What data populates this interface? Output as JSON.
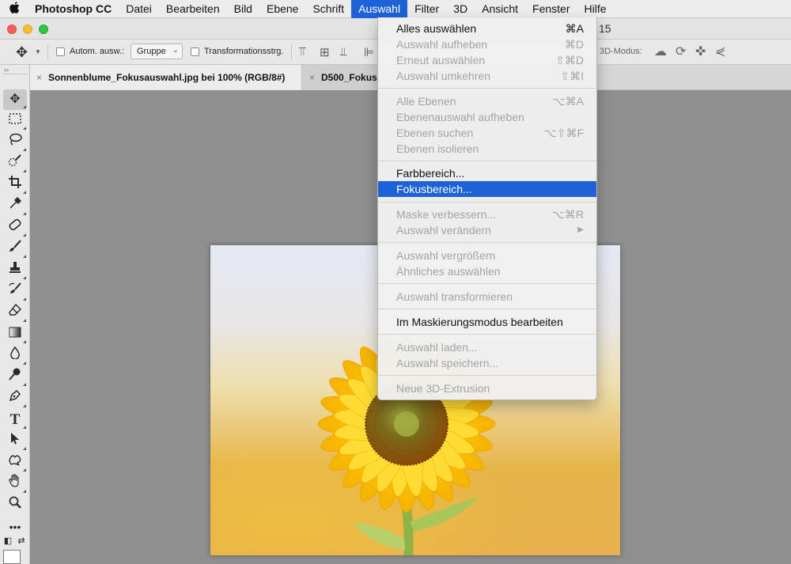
{
  "menubar": {
    "apple": "",
    "app_name": "Photoshop CC",
    "items": [
      "Datei",
      "Bearbeiten",
      "Bild",
      "Ebene",
      "Schrift",
      "Auswahl",
      "Filter",
      "3D",
      "Ansicht",
      "Fenster",
      "Hilfe"
    ],
    "active": "Auswahl"
  },
  "window": {
    "title_fragment": "15"
  },
  "options_bar": {
    "auto_select_label": "Autom. ausw.:",
    "auto_select_checked": false,
    "group_value": "Gruppe",
    "transform_label": "Transformationsstrg.",
    "transform_checked": false,
    "mode_3d_label": "3D-Modus:"
  },
  "tabs": [
    {
      "close": "×",
      "label": "Sonnenblume_Fokusauswahl.jpg bei 100% (RGB/8#)",
      "active": true
    },
    {
      "close": "×",
      "label": "D500_Fokus",
      "active": false
    }
  ],
  "toolbar": {
    "collapse": "››"
  },
  "menu": {
    "items": [
      {
        "label": "Alles auswählen",
        "shortcut": "⌘A",
        "enabled": true
      },
      {
        "label": "Auswahl aufheben",
        "shortcut": "⌘D",
        "enabled": false
      },
      {
        "label": "Erneut auswählen",
        "shortcut": "⇧⌘D",
        "enabled": false
      },
      {
        "label": "Auswahl umkehren",
        "shortcut": "⇧⌘I",
        "enabled": false
      },
      {
        "label": "Alle Ebenen",
        "shortcut": "⌥⌘A",
        "enabled": false
      },
      {
        "label": "Ebenenauswahl aufheben",
        "shortcut": "",
        "enabled": false
      },
      {
        "label": "Ebenen suchen",
        "shortcut": "⌥⇧⌘F",
        "enabled": false
      },
      {
        "label": "Ebenen isolieren",
        "shortcut": "",
        "enabled": false
      },
      {
        "label": "Farbbereich...",
        "shortcut": "",
        "enabled": true
      },
      {
        "label": "Fokusbereich...",
        "shortcut": "",
        "enabled": true,
        "highlighted": true
      },
      {
        "label": "Maske verbessern...",
        "shortcut": "⌥⌘R",
        "enabled": false
      },
      {
        "label": "Auswahl verändern",
        "shortcut": "▶",
        "enabled": false
      },
      {
        "label": "Auswahl vergrößern",
        "shortcut": "",
        "enabled": false
      },
      {
        "label": "Ähnliches auswählen",
        "shortcut": "",
        "enabled": false
      },
      {
        "label": "Auswahl transformieren",
        "shortcut": "",
        "enabled": false
      },
      {
        "label": "Im Maskierungsmodus bearbeiten",
        "shortcut": "",
        "enabled": true
      },
      {
        "label": "Auswahl laden...",
        "shortcut": "",
        "enabled": false
      },
      {
        "label": "Auswahl speichern...",
        "shortcut": "",
        "enabled": false
      },
      {
        "label": "Neue 3D-Extrusion",
        "shortcut": "",
        "enabled": false
      }
    ]
  },
  "colors": {
    "accent": "#1d62d6",
    "canvas": "#8f8f8f",
    "disabled_text": "#a3a3a3"
  }
}
